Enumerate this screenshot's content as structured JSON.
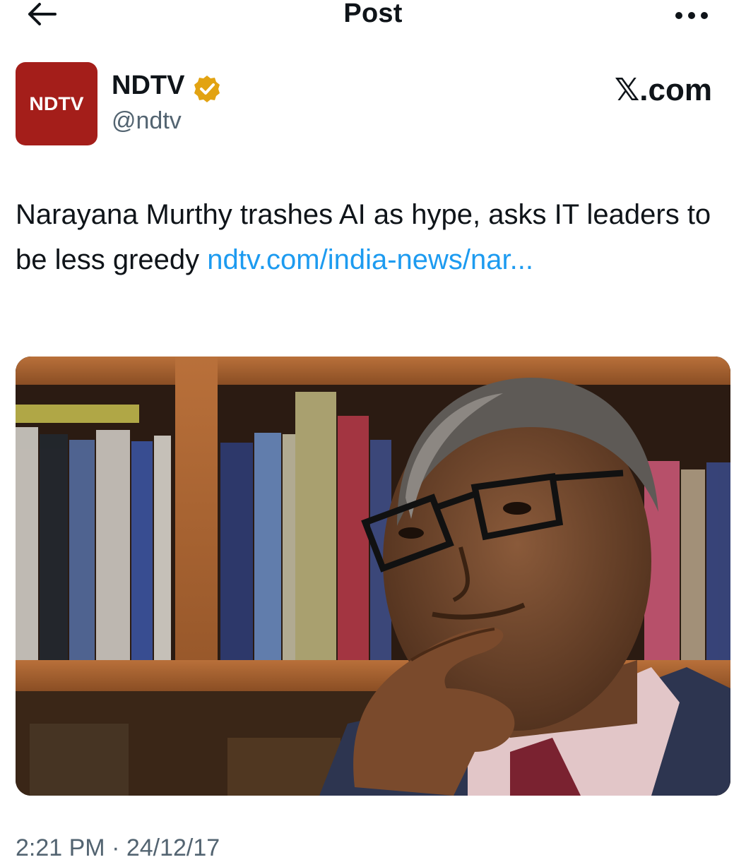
{
  "header": {
    "title": "Post"
  },
  "icons": {
    "back": "arrow-left-icon",
    "more": "more-horizontal-icon",
    "verified": "verified-badge-icon"
  },
  "author": {
    "avatar_text": "NDTV",
    "name": "NDTV",
    "handle": "@ndtv",
    "avatar_color": "#a41e1a",
    "badge_color": "#e2a312"
  },
  "brand": {
    "site": "𝕏.com"
  },
  "post": {
    "text": "Narayana Murthy trashes AI as hype, asks IT leaders to be less greedy ",
    "link_text": "ndtv.com/india-news/nar...",
    "link_color": "#1d9bf0"
  },
  "footer": {
    "timestamp": "2:21 PM · 24/12/17"
  }
}
